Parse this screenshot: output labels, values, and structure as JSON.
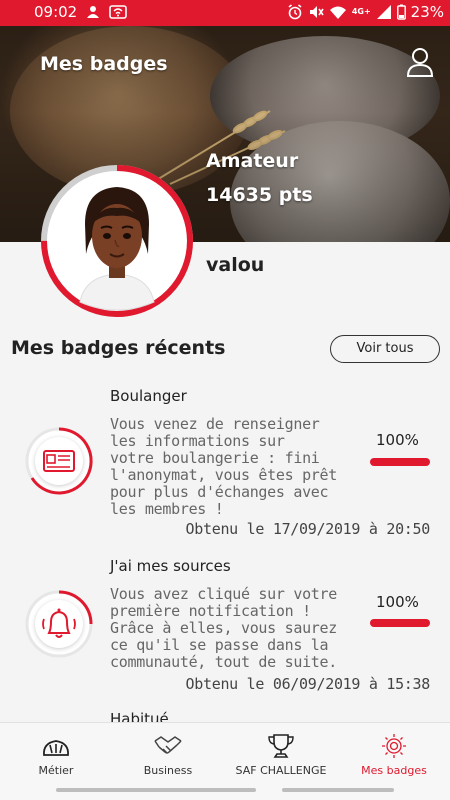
{
  "status_bar": {
    "time": "09:02",
    "network": "4G+",
    "battery": "23%"
  },
  "header": {
    "title": "Mes badges",
    "profile_icon": "user-icon"
  },
  "profile": {
    "level": "Amateur",
    "points": "14635 pts",
    "username": "valou",
    "level_progress": 0.75
  },
  "recent": {
    "title": "Mes badges récents",
    "see_all_label": "Voir tous",
    "badges": [
      {
        "name": "Boulanger",
        "description": "Vous venez de renseigner les informations sur votre boulangerie : fini l'anonymat, vous êtes prêt pour plus d'échanges avec les membres !",
        "description_lines": [
          "Vous venez de renseigner",
          "les informations sur",
          "votre boulangerie : fini",
          "l'anonymat, vous êtes prêt",
          "pour plus d'échanges avec",
          "les membres !"
        ],
        "percent": "100%",
        "progress": 1.0,
        "date": "Obtenu le 17/09/2019 à 20:50",
        "icon": "id-card-icon"
      },
      {
        "name": "J'ai mes sources",
        "description": "Vous avez cliqué sur votre première notification ! Grâce à elles, vous saurez ce qu'il se passe dans la communauté, tout de suite.",
        "description_lines": [
          "Vous avez cliqué sur votre",
          "première notification !",
          "Grâce à elles, vous saurez",
          "ce qu'il se passe dans la",
          "communauté, tout de suite."
        ],
        "percent": "100%",
        "progress": 1.0,
        "date": "Obtenu le 06/09/2019 à 15:38",
        "icon": "bell-icon"
      }
    ],
    "next_badge_name": "Habitué"
  },
  "nav": {
    "items": [
      {
        "label": "Métier",
        "icon": "bread-icon"
      },
      {
        "label": "Business",
        "icon": "handshake-icon"
      },
      {
        "label": "SAF CHALLENGE",
        "icon": "trophy-icon"
      },
      {
        "label": "Mes badges",
        "icon": "badge-icon",
        "active": true
      }
    ]
  },
  "colors": {
    "accent": "#e0192e",
    "background": "#f4f4f4"
  }
}
